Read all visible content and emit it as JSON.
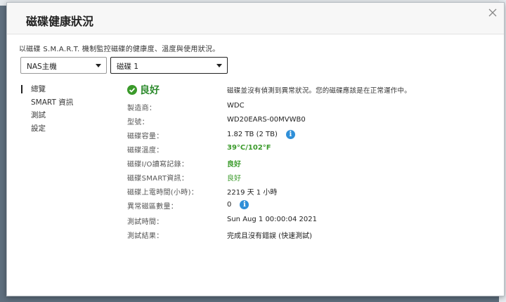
{
  "dialog": {
    "title": "磁碟健康狀況",
    "description": "以磁碟 S.M.A.R.T. 機制監控磁碟的健康度、溫度與使用狀況。",
    "device_select": {
      "value": "NAS主機"
    },
    "disk_select": {
      "value": "磁碟 1"
    }
  },
  "nav": {
    "items": [
      {
        "label": "總覽",
        "active": true
      },
      {
        "label": "SMART 資訊",
        "active": false
      },
      {
        "label": "測試",
        "active": false
      },
      {
        "label": "設定",
        "active": false
      }
    ]
  },
  "summary": {
    "status": "良好",
    "message": "磁碟並沒有偵測到異常狀況。您的磁碟應該是在正常運作中。",
    "status_color": "#2e8b2e"
  },
  "details": [
    {
      "label": "製造商：",
      "value": "WDC"
    },
    {
      "label": "型號：",
      "value": "WD20EARS-00MVWB0"
    },
    {
      "label": "磁碟容量：",
      "value": "1.82 TB (2 TB)",
      "icon": "info-icon"
    },
    {
      "label": "磁碟溫度：",
      "value": "39°C/102°F"
    },
    {
      "label": "磁碟I/O讀寫記錄：",
      "value": "良好"
    },
    {
      "label": "磁碟SMART資訊：",
      "value": "良好"
    },
    {
      "label": "磁碟上電時間(小時)：",
      "value": "2219 天 1 小時"
    },
    {
      "label": "異常磁區數量：",
      "value": "0",
      "icon": "info-icon"
    },
    {
      "label": "測試時間：",
      "value": "Sun Aug 1 00:00:04 2021"
    },
    {
      "label": "測試結果：",
      "value": "完成且沒有錯誤 (快速測試)"
    }
  ],
  "colors": {
    "accent_blue": "#2f8fd8",
    "good_green": "#3a9a2a"
  }
}
